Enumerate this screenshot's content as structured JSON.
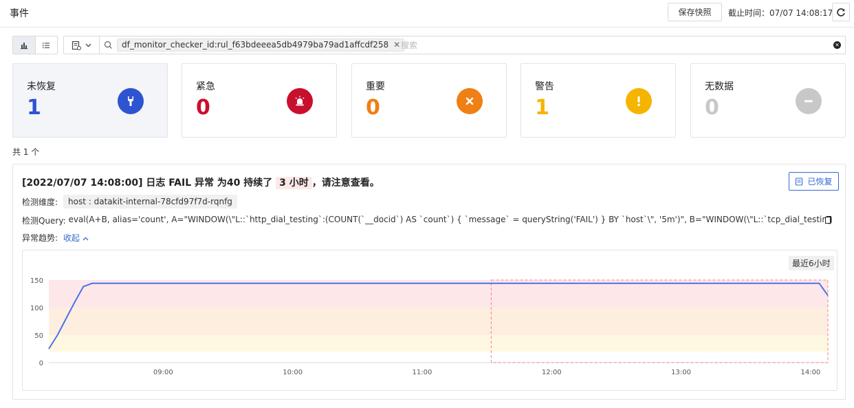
{
  "header": {
    "title": "事件",
    "snapshot_label": "保存快照",
    "deadline_label": "截止时间：",
    "deadline_value": "07/07 14:08:17"
  },
  "search": {
    "tag": "df_monitor_checker_id:rul_f63bdeeea5db4979ba79ad1affcdf258",
    "placeholder": "搜索"
  },
  "stats": [
    {
      "label": "未恢复",
      "count": "1",
      "color": "#2f54d0",
      "icon": "wrench-icon"
    },
    {
      "label": "紧急",
      "count": "0",
      "color": "#c8102e",
      "icon": "alarm-siren-icon"
    },
    {
      "label": "重要",
      "count": "0",
      "color": "#f07f14",
      "icon": "x-mark-icon"
    },
    {
      "label": "警告",
      "count": "1",
      "color": "#f5b400",
      "icon": "exclamation-icon"
    },
    {
      "label": "无数据",
      "count": "0",
      "color": "#c8c8c8",
      "icon": "minus-icon"
    }
  ],
  "total_text": "共 1 个",
  "event": {
    "title_prefix": "[2022/07/07 14:08:00] 日志 FAIL 异常 为40 持续了",
    "duration": "3 小时",
    "title_suffix": "，请注意查看。",
    "status_label": "已恢复",
    "dimension_label": "检测维度:",
    "dimension_value": "host : datakit-internal-78cfd97f7d-rqnfg",
    "query_label": "检测Query:",
    "query_text": "eval(A+B, alias='count', A=\"WINDOW(\\\"L::`http_dial_testing`:(COUNT(`__docid`) AS `count`) { `message` = queryString('FAIL') } BY `host`\\\", '5m')\", B=\"WINDOW(\\\"L::`tcp_dial_testing`:(COUNT(`__docid`) AS `count`) { `message` = queryString('FAIL') } BY `host`\\\", '5m')\")",
    "trend_label": "异常趋势:",
    "collapse_label": "收起"
  },
  "chart_data": {
    "type": "line",
    "range_label": "最近6小时",
    "x_ticks": [
      "09:00",
      "10:00",
      "11:00",
      "12:00",
      "13:00",
      "14:00"
    ],
    "y_ticks": [
      0,
      50,
      100,
      150
    ],
    "ylim": [
      0,
      150
    ],
    "xlim": [
      "08:07",
      "14:08"
    ],
    "bands": [
      {
        "from": 20,
        "to": 50,
        "color": "#fff8e1"
      },
      {
        "from": 50,
        "to": 100,
        "color": "#fdeee0"
      },
      {
        "from": 100,
        "to": 150,
        "color": "#fde7e9"
      }
    ],
    "anomaly_range": [
      "11:32",
      "14:08"
    ],
    "series": [
      {
        "color": "#4a72e8",
        "points": [
          [
            "08:07",
            25
          ],
          [
            "08:11",
            50
          ],
          [
            "08:15",
            80
          ],
          [
            "08:19",
            110
          ],
          [
            "08:23",
            138
          ],
          [
            "08:27",
            144
          ],
          [
            "09:00",
            144
          ],
          [
            "10:00",
            144
          ],
          [
            "11:00",
            144
          ],
          [
            "12:00",
            144
          ],
          [
            "13:00",
            144
          ],
          [
            "14:00",
            144
          ],
          [
            "14:04",
            144
          ],
          [
            "14:08",
            122
          ]
        ]
      }
    ]
  }
}
